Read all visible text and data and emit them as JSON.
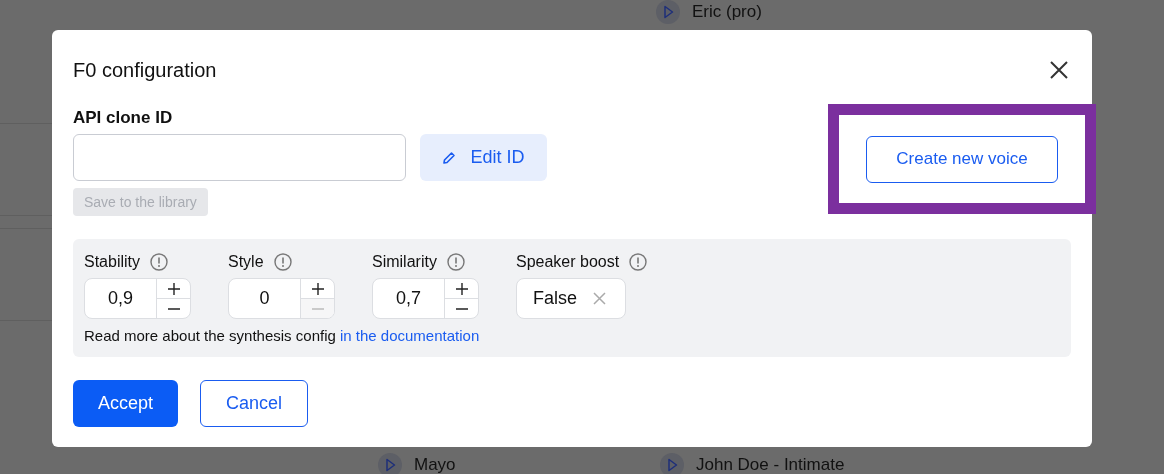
{
  "background_list": [
    {
      "label": "Eric (pro)"
    },
    {
      "label": "Mayo"
    },
    {
      "label": "John Doe - Intimate"
    }
  ],
  "window": {
    "title": "F0 configuration"
  },
  "api_clone_id": {
    "label": "API clone ID"
  },
  "edit_button": {
    "label": "Edit ID"
  },
  "save_button": {
    "label": "Save to the library",
    "disabled": true
  },
  "create_button": {
    "label": "Create new voice",
    "highlighted": true
  },
  "params": [
    {
      "kind": "stepper",
      "label": "Stability",
      "value": "0,9",
      "minus_disabled": false
    },
    {
      "kind": "stepper",
      "label": "Style",
      "value": "0",
      "minus_disabled": true
    },
    {
      "kind": "stepper",
      "label": "Similarity",
      "value": "0,7",
      "minus_disabled": false
    },
    {
      "kind": "toggle",
      "label": "Speaker boost",
      "value": "False"
    }
  ],
  "note": {
    "text": "Read more about the synthesis config",
    "link": "in the documentation"
  },
  "actions": [
    {
      "label": "Accept",
      "kind": "primary"
    },
    {
      "label": "Cancel",
      "kind": "secondary"
    }
  ]
}
